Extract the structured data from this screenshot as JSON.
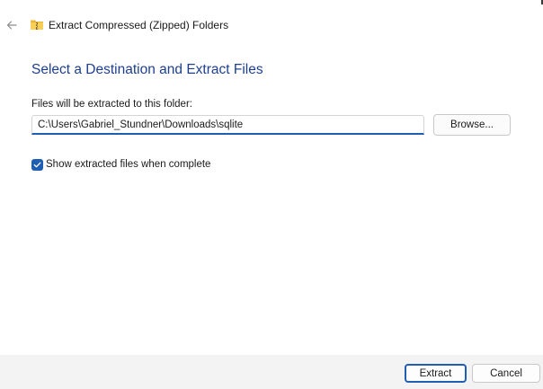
{
  "window": {
    "title": "Extract Compressed (Zipped) Folders"
  },
  "page": {
    "heading": "Select a Destination and Extract Files"
  },
  "destination": {
    "label": "Files will be extracted to this folder:",
    "path": "C:\\Users\\Gabriel_Stundner\\Downloads\\sqlite",
    "browse_label": "Browse..."
  },
  "options": {
    "show_files_label": "Show extracted files when complete",
    "show_files_checked": true
  },
  "footer": {
    "extract_label": "Extract",
    "cancel_label": "Cancel"
  },
  "icons": {
    "back": "back-arrow-icon",
    "folder": "zipped-folder-icon",
    "check": "checkmark-icon"
  },
  "colors": {
    "accent": "#1e5fb4",
    "heading": "#1e3f8f",
    "footer_bg": "#f3f3f3"
  }
}
